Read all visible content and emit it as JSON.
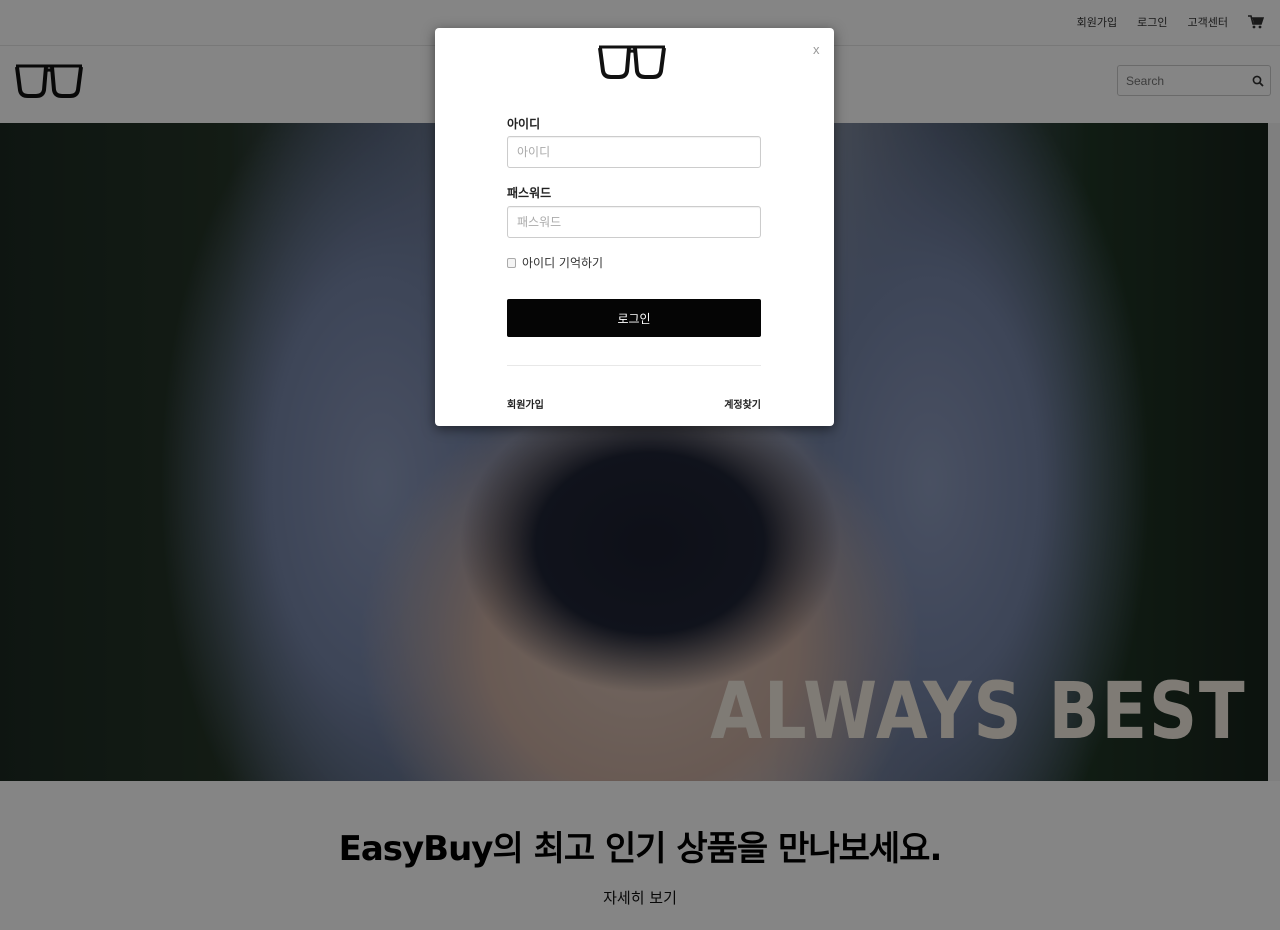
{
  "topbar": {
    "links": [
      "회원가입",
      "로그인",
      "고객센터"
    ],
    "cart_icon": "cart-icon"
  },
  "header": {
    "logo_icon": "glasses-icon",
    "search": {
      "placeholder": "Search",
      "value": "",
      "button_icon": "search-icon"
    }
  },
  "hero": {
    "text": "ALWAYS BEST"
  },
  "promo": {
    "title": "EasyBuy의 최고 인기 상품을 만나보세요.",
    "link": "자세히 보기"
  },
  "modal": {
    "logo_icon": "glasses-icon",
    "close_label": "x",
    "id_label": "아이디",
    "id_placeholder": "아이디",
    "password_label": "패스워드",
    "password_placeholder": "패스워드",
    "remember_label": "아이디 기억하기",
    "remember_checked": false,
    "login_button": "로그인",
    "signup_link": "회원가입",
    "find_account_link": "계정찾기"
  },
  "colors": {
    "overlay": "#000000",
    "hero_text": "#f3ece1",
    "login_button": "#050505"
  }
}
